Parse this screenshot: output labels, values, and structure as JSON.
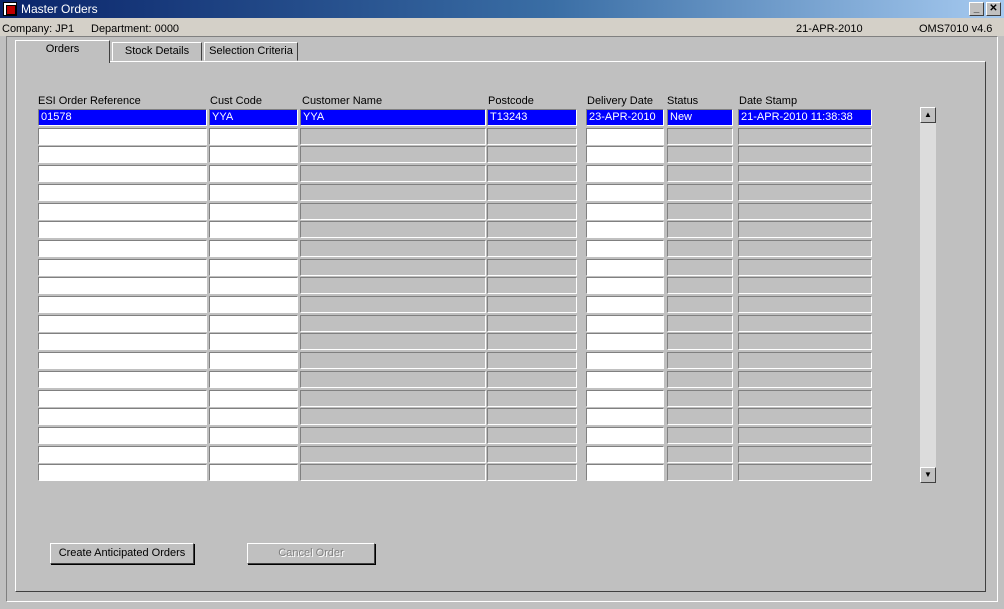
{
  "window": {
    "title": "Master Orders",
    "min_glyph": "_",
    "close_glyph": "✕"
  },
  "infobar": {
    "company": "Company:  JP1",
    "department": "Department:  0000",
    "date": "21-APR-2010",
    "version": "OMS7010  v4.6"
  },
  "tabs": [
    {
      "label": "Orders",
      "active": true
    },
    {
      "label": "Stock Details",
      "active": false
    },
    {
      "label": "Selection Criteria",
      "active": false
    }
  ],
  "columns": [
    "ESI Order Reference",
    "Cust Code",
    "Customer Name",
    "Postcode",
    "Delivery Date",
    "Status",
    "Date Stamp"
  ],
  "rows": [
    [
      "01578",
      "YYA",
      "YYA",
      "T13243",
      "23-APR-2010",
      "New",
      "21-APR-2010 11:38:38"
    ]
  ],
  "empty_row_count": 19,
  "scrollbar": {
    "up_glyph": "▲",
    "down_glyph": "▼"
  },
  "buttons": {
    "create_label": "Create Anticipated Orders",
    "cancel_label": "Cancel Order"
  },
  "colors": {
    "selection": "#0000ff",
    "title_gradient_start": "#0a246a"
  }
}
